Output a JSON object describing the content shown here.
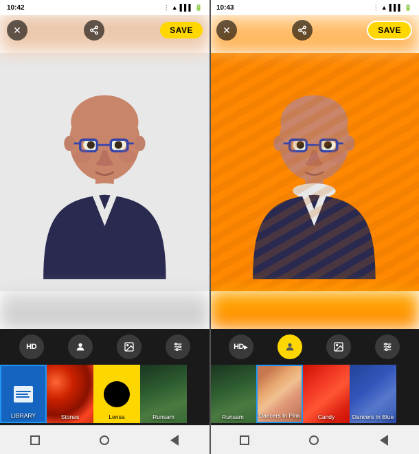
{
  "left_panel": {
    "status_time": "10:42",
    "status_icons": "⚙ ★ ≡ ▶ ▬▬ 📱",
    "save_label": "SAVE",
    "tools": [
      {
        "id": "hd",
        "label": "HD",
        "type": "text"
      },
      {
        "id": "person",
        "label": "👤",
        "type": "icon"
      },
      {
        "id": "gallery",
        "label": "🖼",
        "type": "icon"
      },
      {
        "id": "settings",
        "label": "⚙",
        "type": "icon"
      }
    ],
    "filters": [
      {
        "id": "library",
        "label": "LIBRARY",
        "type": "library",
        "selected": true
      },
      {
        "id": "stones",
        "label": "Stones",
        "type": "stones"
      },
      {
        "id": "lensa",
        "label": "Lensa",
        "type": "lensa"
      },
      {
        "id": "runsam",
        "label": "Runsam",
        "type": "runsam"
      }
    ]
  },
  "right_panel": {
    "status_time": "10:43",
    "save_label": "SAVE",
    "tools": [
      {
        "id": "hd",
        "label": "HD▶",
        "type": "text"
      },
      {
        "id": "person",
        "label": "👤",
        "type": "icon",
        "active": true
      },
      {
        "id": "gallery",
        "label": "🖼",
        "type": "icon"
      },
      {
        "id": "settings",
        "label": "⚙",
        "type": "icon"
      }
    ],
    "filters": [
      {
        "id": "runsam",
        "label": "Runsam",
        "type": "runsam"
      },
      {
        "id": "dancers_pink",
        "label": "Dancers In Pink",
        "type": "dancers_pink",
        "selected": true
      },
      {
        "id": "candy",
        "label": "Candy",
        "type": "candy"
      },
      {
        "id": "dancers_blue",
        "label": "Dancers In Blue",
        "type": "dancers_blue"
      }
    ]
  },
  "nav": {
    "items": [
      {
        "id": "square",
        "label": "■"
      },
      {
        "id": "circle",
        "label": "●"
      },
      {
        "id": "back",
        "label": "◀"
      }
    ]
  }
}
